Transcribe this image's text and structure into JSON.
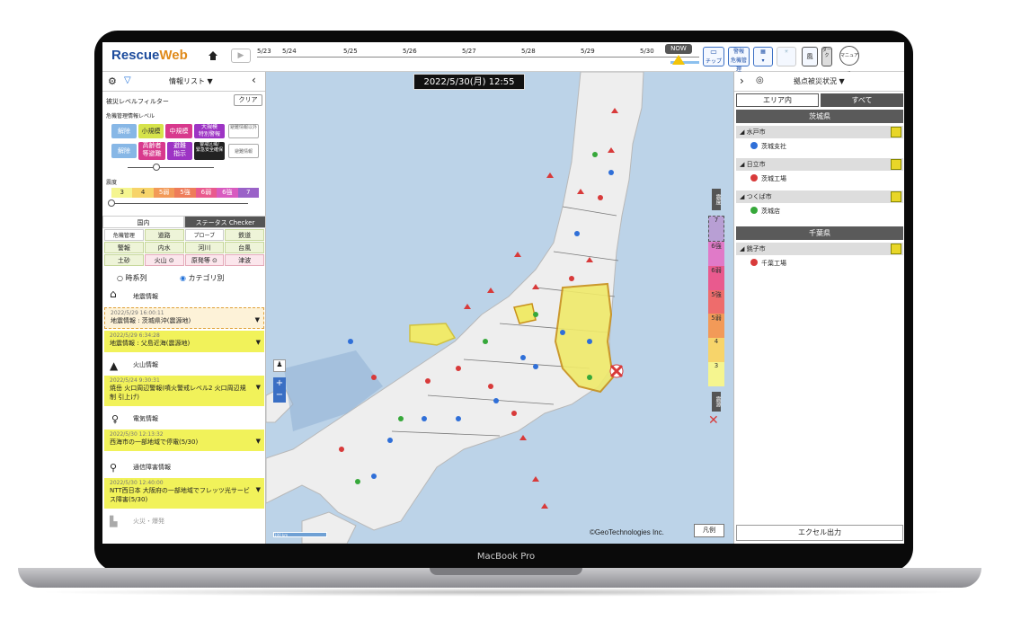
{
  "device_label": "MacBook Pro",
  "app": {
    "logo_a": "Rescue",
    "logo_b": "Web"
  },
  "timeline": {
    "dates": [
      "5/23",
      "5/24",
      "5/25",
      "5/26",
      "5/27",
      "5/28",
      "5/29",
      "5/30"
    ],
    "now": "NOW"
  },
  "toolbar": {
    "chip": "チップ",
    "warn_a": "警報",
    "warn_b": "危機管理",
    "wind": "風",
    "dark": "ダーク",
    "manual": "マニュアル"
  },
  "left": {
    "title": "情報リスト ▼",
    "filter_label": "被災レベルフィルター",
    "clear": "クリア",
    "crisis_label": "危機管理情報レベル",
    "levels_row1": [
      "解除",
      "小規模",
      "中規模",
      "大規模\n特別警報",
      "避難情報以外"
    ],
    "levels_row2": [
      "解除",
      "高齢者\n等避難",
      "避難\n指示",
      "警戒区域/\n緊急安全確保",
      "避難情報"
    ],
    "shindo_label": "震度",
    "shindo": [
      "3",
      "4",
      "5弱",
      "5強",
      "6弱",
      "6強",
      "7"
    ],
    "tabs": [
      "国内",
      "ステータス Checker"
    ],
    "cats": [
      "危機管理",
      "道路",
      "プローブ",
      "鉄道",
      "警報",
      "内水",
      "河川",
      "台風",
      "土砂",
      "火山 ⊙",
      "原発等 ⊙",
      "津波"
    ],
    "radio_a": "時系列",
    "radio_b": "カテゴリ別",
    "groups": [
      {
        "title": "地震情報",
        "items": [
          {
            "ts": "2022/5/29 16:00:11",
            "text": "地震情報 : 茨城県沖(震源地)"
          },
          {
            "ts": "2022/5/29 6:34:28",
            "text": "地震情報 : 父島近海(震源地)"
          }
        ]
      },
      {
        "title": "火山情報",
        "items": [
          {
            "ts": "2022/5/24 9:30:31",
            "text": "焼岳 火口周辺警報(噴火警戒レベル2 火口周辺規制 引上げ)"
          }
        ]
      },
      {
        "title": "電気情報",
        "items": [
          {
            "ts": "2022/5/30 12:13:32",
            "text": "西海市の一部地域で停電(5/30)"
          }
        ]
      },
      {
        "title": "通信障害情報",
        "items": [
          {
            "ts": "2022/5/30 12:40:00",
            "text": "NTT西日本 大阪府の一部地域でフレッツ光サービス障害(5/30)"
          }
        ]
      },
      {
        "title": "火災・爆発",
        "items": []
      }
    ]
  },
  "map": {
    "datetime": "2022/5/30(月) 12:55",
    "copyright": "©GeoTechnologies Inc.",
    "legend": "凡例",
    "scale": "100 km",
    "shindo_bar": [
      "7",
      "6強",
      "6弱",
      "5強",
      "5弱",
      "4",
      "3"
    ],
    "scale_title_a": "震度",
    "scale_title_b": "震源"
  },
  "right": {
    "title": "拠点被災状況 ▼",
    "tab_a": "エリア内",
    "tab_b": "すべて",
    "prefs": [
      {
        "name": "茨城県",
        "cities": [
          {
            "name": "◢ 水戸市",
            "site": "茨城支社",
            "color": "#2f6fd8"
          },
          {
            "name": "◢ 日立市",
            "site": "茨城工場",
            "color": "#d83a3a"
          },
          {
            "name": "◢ つくば市",
            "site": "茨城店",
            "color": "#36a83a"
          }
        ]
      },
      {
        "name": "千葉県",
        "cities": [
          {
            "name": "◢ 銚子市",
            "site": "千葉工場",
            "color": "#d83a3a"
          }
        ]
      }
    ],
    "excel": "エクセル出力"
  }
}
